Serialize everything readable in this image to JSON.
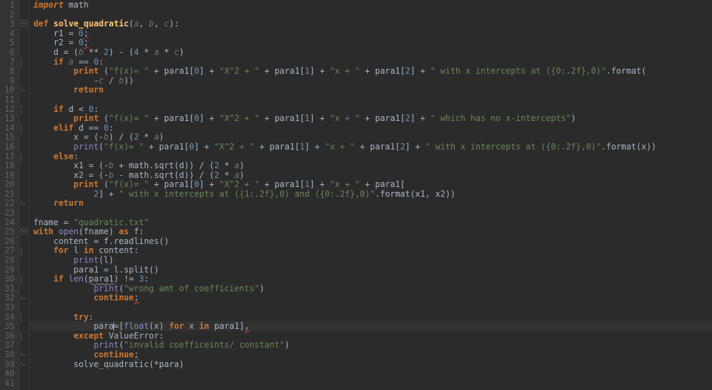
{
  "editor": {
    "cursor_line": 35,
    "line_count": 41,
    "lines": {
      "l1": {
        "t": [
          [
            "kwi",
            "import"
          ],
          [
            "op",
            " math"
          ]
        ]
      },
      "l2": {
        "t": [
          [
            "op",
            ""
          ]
        ]
      },
      "l3": {
        "t": [
          [
            "kw",
            "def "
          ],
          [
            "fn",
            "solve_quadratic"
          ],
          [
            "op",
            "("
          ],
          [
            "arg",
            "a"
          ],
          [
            "op",
            ", "
          ],
          [
            "arg",
            "b"
          ],
          [
            "op",
            ", "
          ],
          [
            "arg",
            "c"
          ],
          [
            "op",
            "):"
          ]
        ]
      },
      "l4": {
        "t": [
          [
            "op",
            "    r1 = "
          ],
          [
            "num",
            "0"
          ],
          [
            "err",
            ";"
          ]
        ]
      },
      "l5": {
        "t": [
          [
            "op",
            "    r2 = "
          ],
          [
            "num",
            "0"
          ],
          [
            "err",
            ";"
          ]
        ]
      },
      "l6": {
        "t": [
          [
            "op",
            "    d = ("
          ],
          [
            "arg",
            "b"
          ],
          [
            "op",
            " ** "
          ],
          [
            "num",
            "2"
          ],
          [
            "op",
            ") - ("
          ],
          [
            "num",
            "4"
          ],
          [
            "op",
            " * "
          ],
          [
            "arg",
            "a"
          ],
          [
            "op",
            " * "
          ],
          [
            "arg",
            "c"
          ],
          [
            "op",
            ")"
          ]
        ]
      },
      "l7": {
        "t": [
          [
            "op",
            "    "
          ],
          [
            "kw",
            "if "
          ],
          [
            "arg",
            "a"
          ],
          [
            "op",
            " == "
          ],
          [
            "num",
            "0"
          ],
          [
            "op",
            ":"
          ]
        ]
      },
      "l8": {
        "t": [
          [
            "op",
            "        "
          ],
          [
            "kw",
            "print"
          ],
          [
            "op",
            " ("
          ],
          [
            "str",
            "\"f(x)= \""
          ],
          [
            "op",
            " + para1["
          ],
          [
            "num",
            "0"
          ],
          [
            "op",
            "] + "
          ],
          [
            "str",
            "\"X^2 + \""
          ],
          [
            "op",
            " + para1["
          ],
          [
            "num",
            "1"
          ],
          [
            "op",
            "] + "
          ],
          [
            "str",
            "\"x + \""
          ],
          [
            "op",
            " + para1["
          ],
          [
            "num",
            "2"
          ],
          [
            "op",
            "] + "
          ],
          [
            "str",
            "\" with x intercepts at ({0:.2f},0)\""
          ],
          [
            "op",
            ".format("
          ]
        ]
      },
      "l9": {
        "t": [
          [
            "op",
            "            -"
          ],
          [
            "arg",
            "c"
          ],
          [
            "op",
            " / "
          ],
          [
            "arg",
            "b"
          ],
          [
            "op",
            "))"
          ]
        ]
      },
      "l10": {
        "t": [
          [
            "op",
            "        "
          ],
          [
            "kw",
            "return"
          ]
        ]
      },
      "l11": {
        "t": [
          [
            "op",
            ""
          ]
        ]
      },
      "l12": {
        "t": [
          [
            "op",
            "    "
          ],
          [
            "kw",
            "if "
          ],
          [
            "op",
            "d < "
          ],
          [
            "num",
            "0"
          ],
          [
            "op",
            ":"
          ]
        ]
      },
      "l13": {
        "t": [
          [
            "op",
            "        "
          ],
          [
            "kw",
            "print"
          ],
          [
            "op",
            " ("
          ],
          [
            "str",
            "\"f(x)= \""
          ],
          [
            "op",
            " + para1["
          ],
          [
            "num",
            "0"
          ],
          [
            "op",
            "] + "
          ],
          [
            "str",
            "\"X^2 + \""
          ],
          [
            "op",
            " + para1["
          ],
          [
            "num",
            "1"
          ],
          [
            "op",
            "] + "
          ],
          [
            "str",
            "\"x + \""
          ],
          [
            "op",
            " + para1["
          ],
          [
            "num",
            "2"
          ],
          [
            "op",
            "] + "
          ],
          [
            "str",
            "\" which has no x-intercepts\""
          ],
          [
            "op",
            ")"
          ]
        ]
      },
      "l14": {
        "t": [
          [
            "op",
            "    "
          ],
          [
            "kw",
            "elif "
          ],
          [
            "op",
            "d == "
          ],
          [
            "num",
            "0"
          ],
          [
            "op",
            ":"
          ]
        ]
      },
      "l15": {
        "t": [
          [
            "op",
            "        x = (-"
          ],
          [
            "arg",
            "b"
          ],
          [
            "op",
            ") / ("
          ],
          [
            "num",
            "2"
          ],
          [
            "op",
            " * "
          ],
          [
            "arg",
            "a"
          ],
          [
            "op",
            ")"
          ]
        ]
      },
      "l16": {
        "t": [
          [
            "op",
            "        "
          ],
          [
            "bi",
            "print"
          ],
          [
            "op",
            "("
          ],
          [
            "str",
            "\"f(x)= \""
          ],
          [
            "op",
            " + para1["
          ],
          [
            "num",
            "0"
          ],
          [
            "op",
            "] + "
          ],
          [
            "str",
            "\"X^2 + \""
          ],
          [
            "op",
            " + para1["
          ],
          [
            "num",
            "1"
          ],
          [
            "op",
            "] + "
          ],
          [
            "str",
            "\"x + \""
          ],
          [
            "op",
            " + para1["
          ],
          [
            "num",
            "2"
          ],
          [
            "op",
            "] + "
          ],
          [
            "str",
            "\" with x intercepts at ({0:.2f},0)\""
          ],
          [
            "op",
            ".format(x))"
          ]
        ]
      },
      "l17": {
        "t": [
          [
            "op",
            "    "
          ],
          [
            "kw",
            "else"
          ],
          [
            "op",
            ":"
          ]
        ]
      },
      "l18": {
        "t": [
          [
            "op",
            "        x1 = (-"
          ],
          [
            "arg",
            "b"
          ],
          [
            "op",
            " + math.sqrt(d)) / ("
          ],
          [
            "num",
            "2"
          ],
          [
            "op",
            " * "
          ],
          [
            "arg",
            "a"
          ],
          [
            "op",
            ")"
          ]
        ]
      },
      "l19": {
        "t": [
          [
            "op",
            "        x2 = (-"
          ],
          [
            "arg",
            "b"
          ],
          [
            "op",
            " - math.sqrt(d)) / ("
          ],
          [
            "num",
            "2"
          ],
          [
            "op",
            " * "
          ],
          [
            "arg",
            "a"
          ],
          [
            "op",
            ")"
          ]
        ]
      },
      "l20": {
        "t": [
          [
            "op",
            "        "
          ],
          [
            "kw",
            "print"
          ],
          [
            "op",
            " ("
          ],
          [
            "str",
            "\"f(x)= \""
          ],
          [
            "op",
            " + para1["
          ],
          [
            "num",
            "0"
          ],
          [
            "op",
            "] + "
          ],
          [
            "str",
            "\"X^2 + \""
          ],
          [
            "op",
            " + para1["
          ],
          [
            "num",
            "1"
          ],
          [
            "op",
            "] + "
          ],
          [
            "str",
            "\"x + \""
          ],
          [
            "op",
            " + para1["
          ]
        ]
      },
      "l21": {
        "t": [
          [
            "op",
            "            "
          ],
          [
            "num",
            "2"
          ],
          [
            "op",
            "] + "
          ],
          [
            "str",
            "\" with x intercepts at ({1:.2f},0) and ({0:.2f},0)\""
          ],
          [
            "op",
            ".format(x1, x2))"
          ]
        ]
      },
      "l22": {
        "t": [
          [
            "op",
            "    "
          ],
          [
            "kw",
            "return"
          ]
        ]
      },
      "l23": {
        "t": [
          [
            "op",
            ""
          ]
        ]
      },
      "l24": {
        "t": [
          [
            "op",
            "fname = "
          ],
          [
            "str",
            "\"quadratic.txt\""
          ]
        ]
      },
      "l25": {
        "t": [
          [
            "kw",
            "with "
          ],
          [
            "bi",
            "open"
          ],
          [
            "op",
            "(fname) "
          ],
          [
            "kw",
            "as "
          ],
          [
            "op",
            "f:"
          ]
        ]
      },
      "l26": {
        "t": [
          [
            "op",
            "    content = f.readlines()"
          ]
        ]
      },
      "l27": {
        "t": [
          [
            "op",
            "    "
          ],
          [
            "kw",
            "for "
          ],
          [
            "op",
            "l "
          ],
          [
            "kw",
            "in "
          ],
          [
            "op",
            "content:"
          ]
        ]
      },
      "l28": {
        "t": [
          [
            "op",
            "        "
          ],
          [
            "bi",
            "print"
          ],
          [
            "op",
            "(l)"
          ]
        ]
      },
      "l29": {
        "t": [
          [
            "op",
            "        para1 = l.split()"
          ]
        ]
      },
      "l30": {
        "t": [
          [
            "op",
            "    "
          ],
          [
            "kw",
            "if "
          ],
          [
            "bi",
            "len"
          ],
          [
            "op",
            "("
          ],
          [
            "warn",
            "para1"
          ],
          [
            "op",
            ") != "
          ],
          [
            "num",
            "3"
          ],
          [
            "op",
            ":"
          ]
        ]
      },
      "l31": {
        "t": [
          [
            "op",
            "            "
          ],
          [
            "bi",
            "print"
          ],
          [
            "op",
            "("
          ],
          [
            "str",
            "\"wrong amt of coefficients\""
          ],
          [
            "op",
            ")"
          ]
        ]
      },
      "l32": {
        "t": [
          [
            "op",
            "            "
          ],
          [
            "kw",
            "continue"
          ],
          [
            "err",
            ";"
          ]
        ]
      },
      "l33": {
        "t": [
          [
            "op",
            ""
          ]
        ]
      },
      "l34": {
        "t": [
          [
            "op",
            "        "
          ],
          [
            "kw",
            "try"
          ],
          [
            "op",
            ":"
          ]
        ]
      },
      "l35": {
        "t": [
          [
            "op",
            "            para"
          ],
          [
            "caret",
            ""
          ],
          [
            "op",
            "=["
          ],
          [
            "bi",
            "float"
          ],
          [
            "op",
            "(x) "
          ],
          [
            "kw",
            "for "
          ],
          [
            "op",
            "x "
          ],
          [
            "kw",
            "in "
          ],
          [
            "op",
            "para1]"
          ],
          [
            "err",
            ","
          ]
        ]
      },
      "l36": {
        "t": [
          [
            "op",
            "        "
          ],
          [
            "kw",
            "except "
          ],
          [
            "op",
            "ValueError:"
          ]
        ]
      },
      "l37": {
        "t": [
          [
            "op",
            "            "
          ],
          [
            "bi",
            "print"
          ],
          [
            "op",
            "("
          ],
          [
            "str",
            "\"invalid coefficeints/ constant\""
          ],
          [
            "op",
            ")"
          ]
        ]
      },
      "l38": {
        "t": [
          [
            "op",
            "            "
          ],
          [
            "kw",
            "continue"
          ],
          [
            "err",
            ";"
          ]
        ]
      },
      "l39": {
        "t": [
          [
            "op",
            "        solve_quadratic("
          ],
          [
            "op",
            "*"
          ],
          [
            "op",
            "para)"
          ]
        ]
      },
      "l40": {
        "t": [
          [
            "op",
            ""
          ]
        ]
      },
      "l41": {
        "t": [
          [
            "op",
            ""
          ]
        ]
      }
    },
    "fold_marks": [
      {
        "line": 3,
        "type": "minus"
      },
      {
        "line": 7,
        "type": "bar"
      },
      {
        "line": 10,
        "type": "end"
      },
      {
        "line": 12,
        "type": "bar"
      },
      {
        "line": 14,
        "type": "bar"
      },
      {
        "line": 17,
        "type": "bar"
      },
      {
        "line": 22,
        "type": "end"
      },
      {
        "line": 25,
        "type": "minus"
      },
      {
        "line": 27,
        "type": "bar"
      },
      {
        "line": 30,
        "type": "bar"
      },
      {
        "line": 32,
        "type": "end"
      },
      {
        "line": 34,
        "type": "bar"
      },
      {
        "line": 36,
        "type": "bar"
      },
      {
        "line": 38,
        "type": "end"
      },
      {
        "line": 39,
        "type": "end"
      }
    ]
  }
}
